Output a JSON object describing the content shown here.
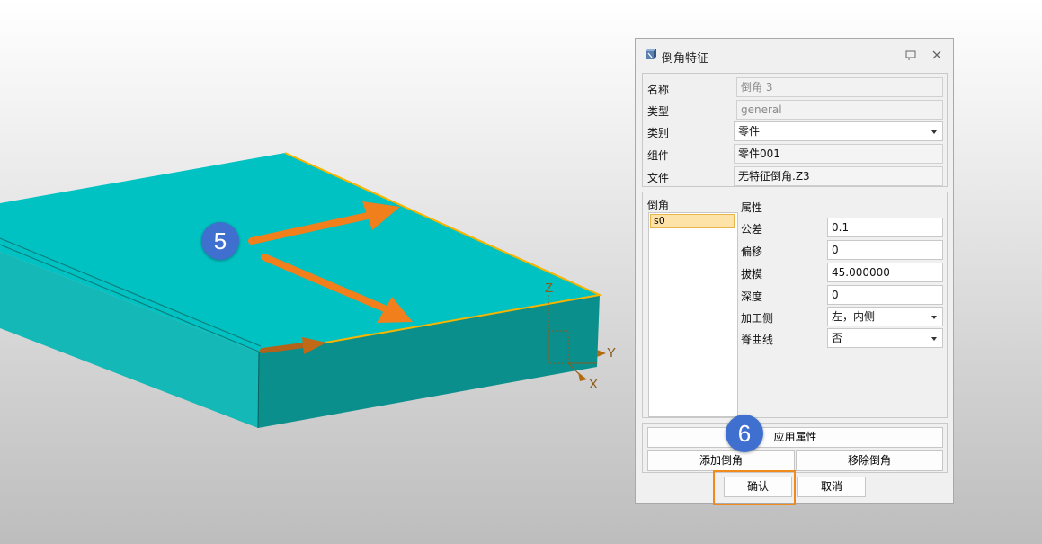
{
  "badges": {
    "step5": "5",
    "step6": "6"
  },
  "axes": {
    "z": "Z",
    "y": "Y",
    "x": "X"
  },
  "colors": {
    "top_face": "#00c2c2",
    "side_face": "#0b8f8c",
    "edge_highlight": "#f7b500",
    "arrow": "#f07f1c",
    "badge": "#3f6fcf"
  },
  "dialog": {
    "title": "倒角特征",
    "icons": {
      "title": "chamfer-feature-icon",
      "pin": "pin-icon",
      "close": "close-icon"
    },
    "info": {
      "name_label": "名称",
      "name_value": "倒角 3",
      "type_label": "类型",
      "type_value": "general",
      "category_label": "类别",
      "category_value": "零件",
      "component_label": "组件",
      "component_value": "零件001",
      "file_label": "文件",
      "file_value": "无特征倒角.Z3"
    },
    "chamfer_list": {
      "header": "倒角",
      "items": [
        "s0"
      ]
    },
    "properties": {
      "header": "属性",
      "tolerance_label": "公差",
      "tolerance_value": "0.1",
      "offset_label": "偏移",
      "offset_value": "0",
      "draft_label": "拔模",
      "draft_value": "45.000000",
      "depth_label": "深度",
      "depth_value": "0",
      "machining_side_label": "加工侧",
      "machining_side_value": "左，内侧",
      "spine_label": "脊曲线",
      "spine_value": "否"
    },
    "buttons": {
      "apply": "应用属性",
      "add": "添加倒角",
      "remove": "移除倒角",
      "ok": "确认",
      "cancel": "取消"
    }
  }
}
